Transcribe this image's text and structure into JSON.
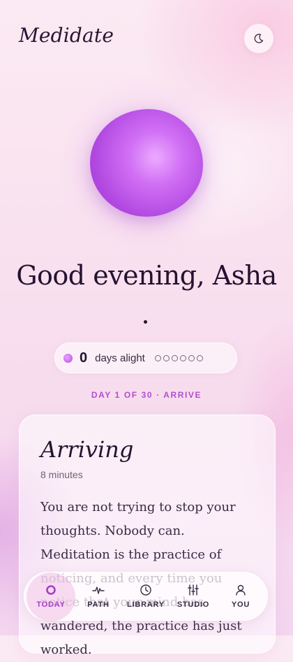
{
  "header": {
    "brand": "Medidate",
    "theme_toggle_icon": "moon-icon"
  },
  "hero": {
    "orb_icon": "breathing-orb",
    "greeting": "Good evening, Asha",
    "dot": "."
  },
  "streak": {
    "count": "0",
    "label": "days alight",
    "week_progress_filled": 0,
    "week_progress_total": 6
  },
  "program": {
    "label": "DAY 1 OF 30 · ARRIVE"
  },
  "card": {
    "title": "Arriving",
    "duration": "8 minutes",
    "body": "You are not trying to stop your thoughts. Nobody can. Meditation is the practice of noticing, and every time you notice that your mind has wandered, the practice has just worked."
  },
  "nav": {
    "items": [
      {
        "label": "TODAY",
        "icon": "ring-icon",
        "active": true
      },
      {
        "label": "PATH",
        "icon": "pulse-icon",
        "active": false
      },
      {
        "label": "LIBRARY",
        "icon": "clock-icon",
        "active": false
      },
      {
        "label": "STUDIO",
        "icon": "sliders-icon",
        "active": false
      },
      {
        "label": "YOU",
        "icon": "person-icon",
        "active": false
      }
    ]
  },
  "colors": {
    "accent": "#b24fd2",
    "text": "#241330",
    "orb": "#c25ef0"
  }
}
